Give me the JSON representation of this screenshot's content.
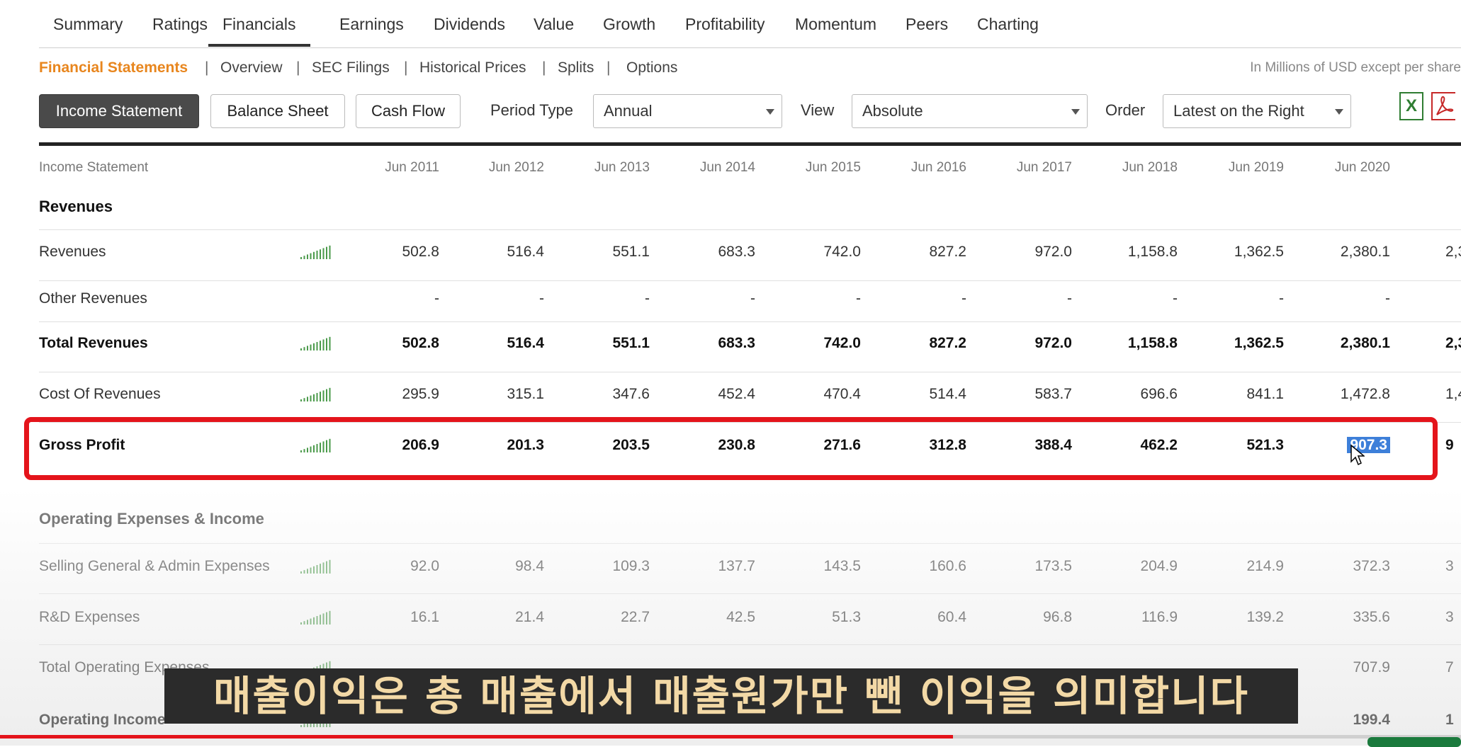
{
  "tabs": [
    "Summary",
    "Ratings",
    "Financials",
    "Earnings",
    "Dividends",
    "Value",
    "Growth",
    "Profitability",
    "Momentum",
    "Peers",
    "Charting"
  ],
  "subnav": [
    "Financial Statements",
    "Overview",
    "SEC Filings",
    "Historical Prices",
    "Splits",
    "Options"
  ],
  "units_note": "In Millions of USD except per share",
  "toolbar": {
    "income": "Income Statement",
    "balance": "Balance Sheet",
    "cash": "Cash Flow",
    "period_label": "Period Type",
    "period_value": "Annual",
    "view_label": "View",
    "view_value": "Absolute",
    "order_label": "Order",
    "order_value": "Latest on the Right",
    "excel_glyph": "X"
  },
  "table": {
    "header_label": "Income Statement",
    "years": [
      "Jun 2011",
      "Jun 2012",
      "Jun 2013",
      "Jun 2014",
      "Jun 2015",
      "Jun 2016",
      "Jun 2017",
      "Jun 2018",
      "Jun 2019",
      "Jun 2020"
    ],
    "sections": {
      "revenues": "Revenues",
      "opex": "Operating Expenses & Income"
    },
    "rows": [
      {
        "label": "Revenues",
        "values": [
          "502.8",
          "516.4",
          "551.1",
          "683.3",
          "742.0",
          "827.2",
          "972.0",
          "1,158.8",
          "1,362.5",
          "2,380.1"
        ],
        "cut": "2,3"
      },
      {
        "label": "Other Revenues",
        "values": [
          "-",
          "-",
          "-",
          "-",
          "-",
          "-",
          "-",
          "-",
          "-",
          "-"
        ],
        "cut": ""
      },
      {
        "label": "Total Revenues",
        "values": [
          "502.8",
          "516.4",
          "551.1",
          "683.3",
          "742.0",
          "827.2",
          "972.0",
          "1,158.8",
          "1,362.5",
          "2,380.1"
        ],
        "cut": "2,3"
      },
      {
        "label": "Cost Of Revenues",
        "values": [
          "295.9",
          "315.1",
          "347.6",
          "452.4",
          "470.4",
          "514.4",
          "583.7",
          "696.6",
          "841.1",
          "1,472.8"
        ],
        "cut": "1,4"
      },
      {
        "label": "Gross Profit",
        "values": [
          "206.9",
          "201.3",
          "203.5",
          "230.8",
          "271.6",
          "312.8",
          "388.4",
          "462.2",
          "521.3",
          "907.3"
        ],
        "cut": "9"
      },
      {
        "label": "Selling General & Admin Expenses",
        "values": [
          "92.0",
          "98.4",
          "109.3",
          "137.7",
          "143.5",
          "160.6",
          "173.5",
          "204.9",
          "214.9",
          "372.3"
        ],
        "cut": "3"
      },
      {
        "label": "R&D Expenses",
        "values": [
          "16.1",
          "21.4",
          "22.7",
          "42.5",
          "51.3",
          "60.4",
          "96.8",
          "116.9",
          "139.2",
          "335.6"
        ],
        "cut": "3"
      },
      {
        "label": "Total Operating Expenses",
        "values": [
          "",
          "",
          "",
          "",
          "",
          "",
          "",
          "",
          "",
          "707.9"
        ],
        "cut": "7"
      },
      {
        "label": "Operating Income",
        "values": [
          "",
          "",
          "",
          "",
          "",
          "",
          "",
          "",
          "",
          "199.4"
        ],
        "cut": "1"
      }
    ]
  },
  "subtitle": "매출이익은 총 매출에서 매출원가만 뺀 이익을 의미합니다",
  "colors": {
    "accent": "#e8861e",
    "highlight": "#e4141b",
    "selection": "#3d7fd9"
  }
}
